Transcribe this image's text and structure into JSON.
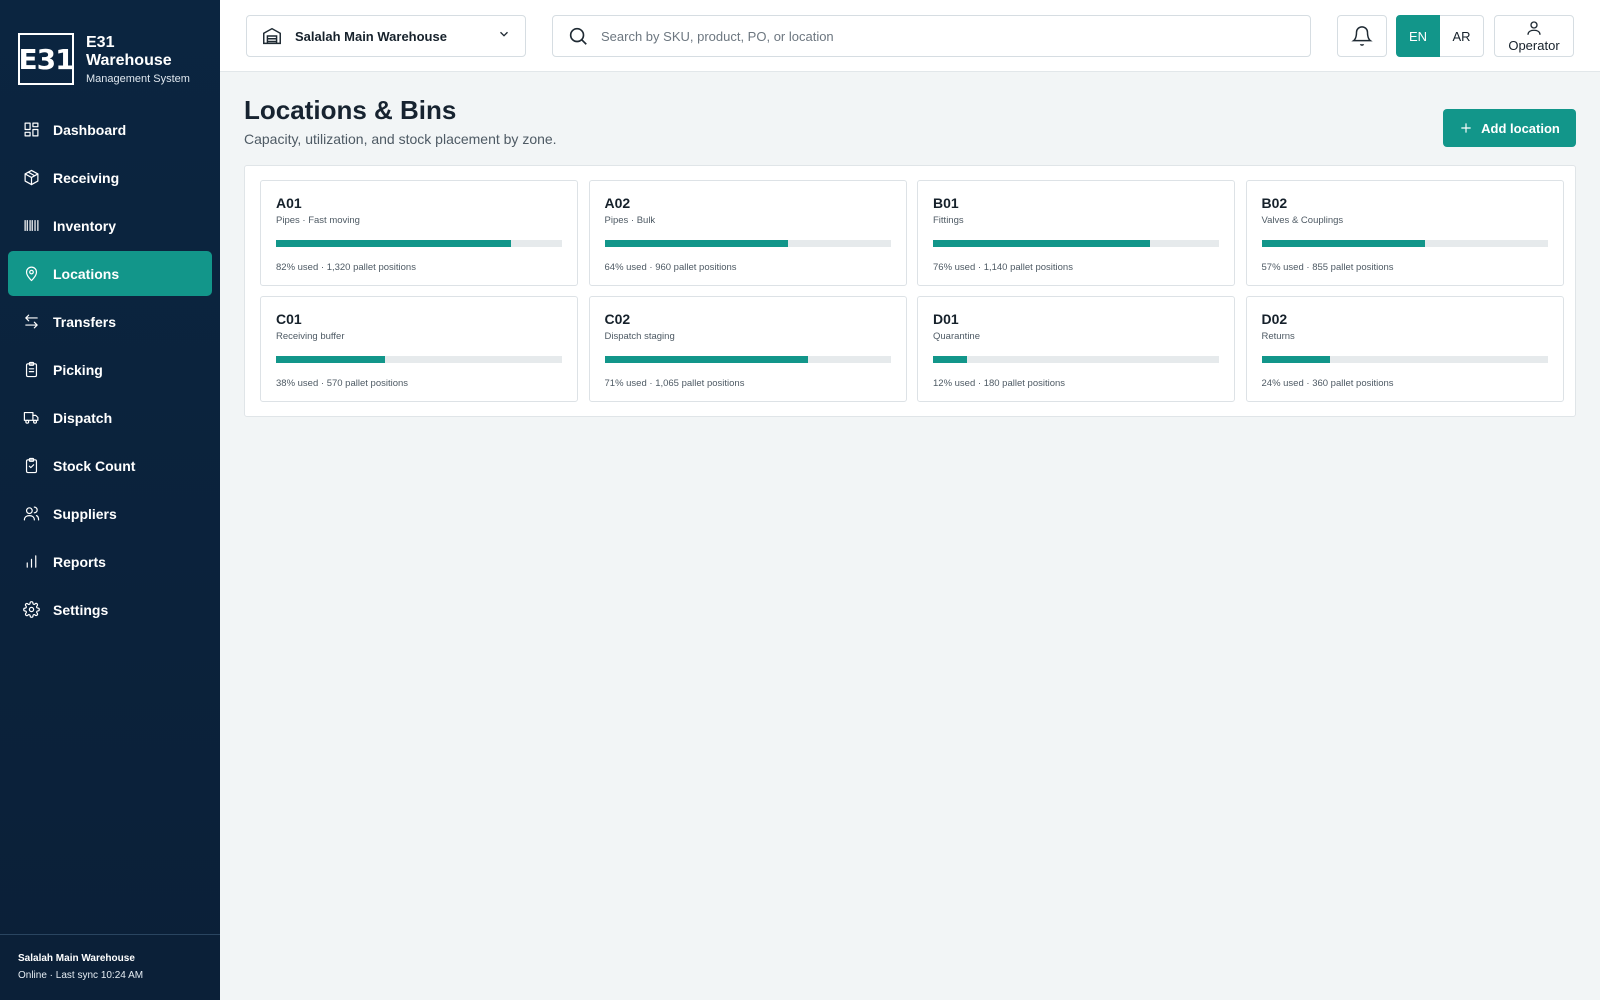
{
  "app": {
    "brand_title": "E31 Warehouse",
    "brand_sub": "Management System",
    "logo_text": "E31"
  },
  "nav": [
    {
      "label": "Dashboard",
      "icon": "dashboard-icon",
      "active": false
    },
    {
      "label": "Receiving",
      "icon": "box-icon",
      "active": false
    },
    {
      "label": "Inventory",
      "icon": "barcode-icon",
      "active": false
    },
    {
      "label": "Locations",
      "icon": "map-pin-icon",
      "active": true
    },
    {
      "label": "Transfers",
      "icon": "arrows-swap-icon",
      "active": false
    },
    {
      "label": "Picking",
      "icon": "clipboard-list-icon",
      "active": false
    },
    {
      "label": "Dispatch",
      "icon": "truck-icon",
      "active": false
    },
    {
      "label": "Stock Count",
      "icon": "clipboard-check-icon",
      "active": false
    },
    {
      "label": "Suppliers",
      "icon": "users-icon",
      "active": false
    },
    {
      "label": "Reports",
      "icon": "bar-chart-icon",
      "active": false
    },
    {
      "label": "Settings",
      "icon": "gear-icon",
      "active": false
    }
  ],
  "footer": {
    "warehouse": "Salalah Main Warehouse",
    "status": "Online · Last sync 10:24 AM"
  },
  "header": {
    "warehouse_select": "Salalah Main Warehouse",
    "search_placeholder": "Search by SKU, product, PO, or location",
    "lang_en": "EN",
    "lang_ar": "AR",
    "user": "Operator"
  },
  "page": {
    "title": "Locations & Bins",
    "subtitle": "Capacity, utilization, and stock placement by zone.",
    "add_button": "Add location"
  },
  "accent_color": "#12968a",
  "locations": [
    {
      "code": "A01",
      "desc": "Pipes · Fast moving",
      "used_pct": 82,
      "meta": "82% used · 1,320 pallet positions"
    },
    {
      "code": "A02",
      "desc": "Pipes · Bulk",
      "used_pct": 64,
      "meta": "64% used · 960 pallet positions"
    },
    {
      "code": "B01",
      "desc": "Fittings",
      "used_pct": 76,
      "meta": "76% used · 1,140 pallet positions"
    },
    {
      "code": "B02",
      "desc": "Valves & Couplings",
      "used_pct": 57,
      "meta": "57% used · 855 pallet positions"
    },
    {
      "code": "C01",
      "desc": "Receiving buffer",
      "used_pct": 38,
      "meta": "38% used · 570 pallet positions"
    },
    {
      "code": "C02",
      "desc": "Dispatch staging",
      "used_pct": 71,
      "meta": "71% used · 1,065 pallet positions"
    },
    {
      "code": "D01",
      "desc": "Quarantine",
      "used_pct": 12,
      "meta": "12% used · 180 pallet positions"
    },
    {
      "code": "D02",
      "desc": "Returns",
      "used_pct": 24,
      "meta": "24% used · 360 pallet positions"
    }
  ]
}
